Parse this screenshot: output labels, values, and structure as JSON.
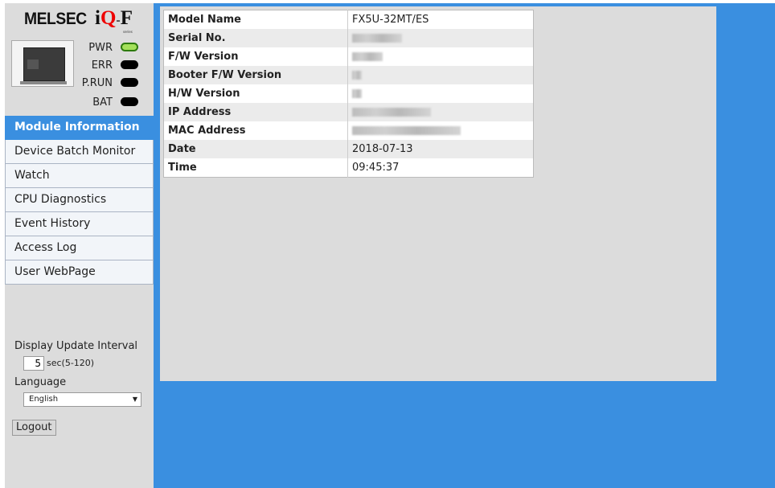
{
  "brand": {
    "melsec": "MELSEC",
    "iq_i": "i",
    "iq_q": "Q",
    "iq_dash": "-",
    "iq_f": "F",
    "series": "series"
  },
  "leds": [
    {
      "label": "PWR",
      "state": "on",
      "color": "#a4e05a"
    },
    {
      "label": "ERR",
      "state": "off",
      "color": "#000000"
    },
    {
      "label": "P.RUN",
      "state": "off",
      "color": "#000000"
    },
    {
      "label": "BAT",
      "state": "off",
      "color": "#000000"
    }
  ],
  "nav": {
    "items": [
      {
        "label": "Module Information",
        "active": true
      },
      {
        "label": "Device Batch Monitor",
        "active": false
      },
      {
        "label": "Watch",
        "active": false
      },
      {
        "label": "CPU Diagnostics",
        "active": false
      },
      {
        "label": "Event History",
        "active": false
      },
      {
        "label": "Access Log",
        "active": false
      },
      {
        "label": "User WebPage",
        "active": false
      }
    ]
  },
  "settings": {
    "interval_label": "Display Update Interval",
    "interval_value": "5",
    "interval_unit": "sec(5-120)",
    "language_label": "Language",
    "language_value": "English",
    "logout_label": "Logout"
  },
  "module_info": {
    "rows": [
      {
        "key": "Model Name",
        "value": "FX5U-32MT/ES",
        "redacted": false
      },
      {
        "key": "Serial No.",
        "value": "",
        "redacted": true
      },
      {
        "key": "F/W Version",
        "value": "",
        "redacted": true
      },
      {
        "key": "Booter F/W Version",
        "value": "",
        "redacted": true
      },
      {
        "key": "H/W Version",
        "value": "",
        "redacted": true
      },
      {
        "key": "IP Address",
        "value": "",
        "redacted": true
      },
      {
        "key": "MAC Address",
        "value": "",
        "redacted": true
      },
      {
        "key": "Date",
        "value": "2018-07-13",
        "redacted": false
      },
      {
        "key": "Time",
        "value": "09:45:37",
        "redacted": false
      }
    ]
  },
  "colors": {
    "accent": "#3a8fe0",
    "panel": "#dcdcdc",
    "led_on": "#a4e05a"
  }
}
